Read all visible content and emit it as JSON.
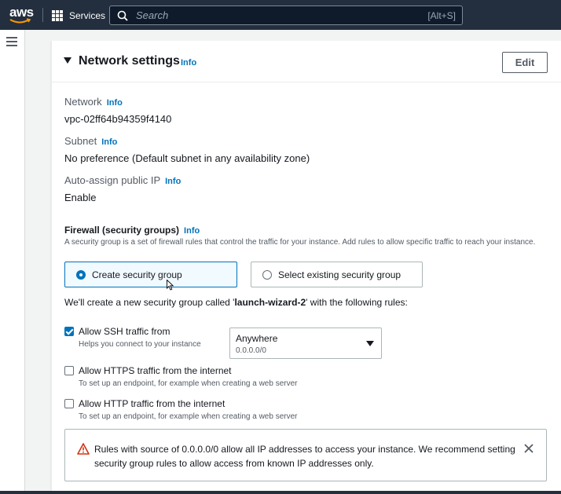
{
  "nav": {
    "logo_text": "aws",
    "services_label": "Services",
    "search_placeholder": "Search",
    "search_shortcut": "[Alt+S]"
  },
  "panel": {
    "title": "Network settings",
    "info_label": "Info",
    "edit_label": "Edit"
  },
  "fields": {
    "network": {
      "label": "Network",
      "info": "Info",
      "value": "vpc-02ff64b94359f4140"
    },
    "subnet": {
      "label": "Subnet",
      "info": "Info",
      "value": "No preference (Default subnet in any availability zone)"
    },
    "public_ip": {
      "label": "Auto-assign public IP",
      "info": "Info",
      "value": "Enable"
    }
  },
  "firewall": {
    "label": "Firewall (security groups)",
    "info": "Info",
    "description": "A security group is a set of firewall rules that control the traffic for your instance. Add rules to allow specific traffic to reach your instance.",
    "options": [
      {
        "label": "Create security group",
        "selected": true
      },
      {
        "label": "Select existing security group",
        "selected": false
      }
    ],
    "wizard_prefix": "We'll create a new security group called '",
    "wizard_name": "launch-wizard-2",
    "wizard_suffix": "' with the following rules:"
  },
  "rules": {
    "ssh": {
      "label": "Allow SSH traffic from",
      "sub": "Helps you connect to your instance",
      "checked": true
    },
    "https": {
      "label": "Allow HTTPS traffic from the internet",
      "sub": "To set up an endpoint, for example when creating a web server",
      "checked": false
    },
    "http": {
      "label": "Allow HTTP traffic from the internet",
      "sub": "To set up an endpoint, for example when creating a web server",
      "checked": false
    }
  },
  "ssh_source": {
    "value": "Anywhere",
    "sub": "0.0.0.0/0"
  },
  "alert": {
    "text": "Rules with source of 0.0.0.0/0 allow all IP addresses to access your instance. We recommend setting security group rules to allow access from known IP addresses only."
  },
  "colors": {
    "nav_bg": "#232f3e",
    "accent": "#0073bb",
    "warning": "#d13212",
    "aws_smile": "#ff9900"
  }
}
